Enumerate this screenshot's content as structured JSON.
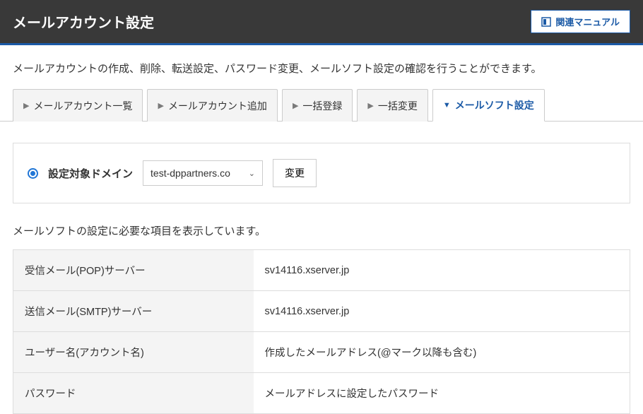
{
  "header": {
    "title": "メールアカウント設定",
    "manual_label": "関連マニュアル"
  },
  "description": "メールアカウントの作成、削除、転送設定、パスワード変更、メールソフト設定の確認を行うことができます。",
  "tabs": [
    {
      "label": "メールアカウント一覧"
    },
    {
      "label": "メールアカウント追加"
    },
    {
      "label": "一括登録"
    },
    {
      "label": "一括変更"
    },
    {
      "label": "メールソフト設定"
    }
  ],
  "domain_selector": {
    "label": "設定対象ドメイン",
    "selected": "test-dppartners.co",
    "change_label": "変更"
  },
  "subdescription": "メールソフトの設定に必要な項目を表示しています。",
  "settings": [
    {
      "key": "受信メール(POP)サーバー",
      "value": "sv14116.xserver.jp"
    },
    {
      "key": "送信メール(SMTP)サーバー",
      "value": "sv14116.xserver.jp"
    },
    {
      "key": "ユーザー名(アカウント名)",
      "value": "作成したメールアドレス(@マーク以降も含む)"
    },
    {
      "key": "パスワード",
      "value": "メールアドレスに設定したパスワード"
    }
  ]
}
